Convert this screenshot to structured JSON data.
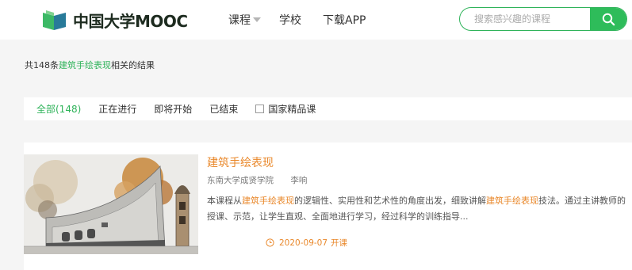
{
  "header": {
    "logo_text": "中国大学MOOC",
    "nav": {
      "courses": "课程",
      "schools": "学校",
      "download": "下载APP"
    },
    "search": {
      "placeholder": "搜索感兴趣的课程",
      "value": ""
    }
  },
  "summary": {
    "prefix": "共148条",
    "keyword": "建筑手绘表现",
    "suffix": "相关的结果"
  },
  "filters": {
    "all": "全部(148)",
    "ongoing": "正在进行",
    "upcoming": "即将开始",
    "ended": "已结束",
    "national": "国家精品课",
    "national_checked": false
  },
  "result": {
    "title": "建筑手绘表现",
    "school": "东南大学成贤学院",
    "teacher": "李响",
    "desc": {
      "p1": "本课程从",
      "k1": "建筑手绘表现",
      "p2": "的逻辑性、实用性和艺术性的角度出发，细致讲解",
      "k2": "建筑手绘表现",
      "p3": "技法。通过主讲教师的授课、示范，让学生直观、全面地进行学习，经过科学的训练指导..."
    },
    "start_date": "2020-09-07",
    "open_label": "开课"
  },
  "colors": {
    "brand_green": "#2fb35a",
    "highlight_orange": "#e9882b"
  },
  "icons": {
    "search": "search-icon",
    "clock": "clock-icon",
    "logo": "mooc-logo-icon",
    "dropdown": "caret-down-icon"
  }
}
